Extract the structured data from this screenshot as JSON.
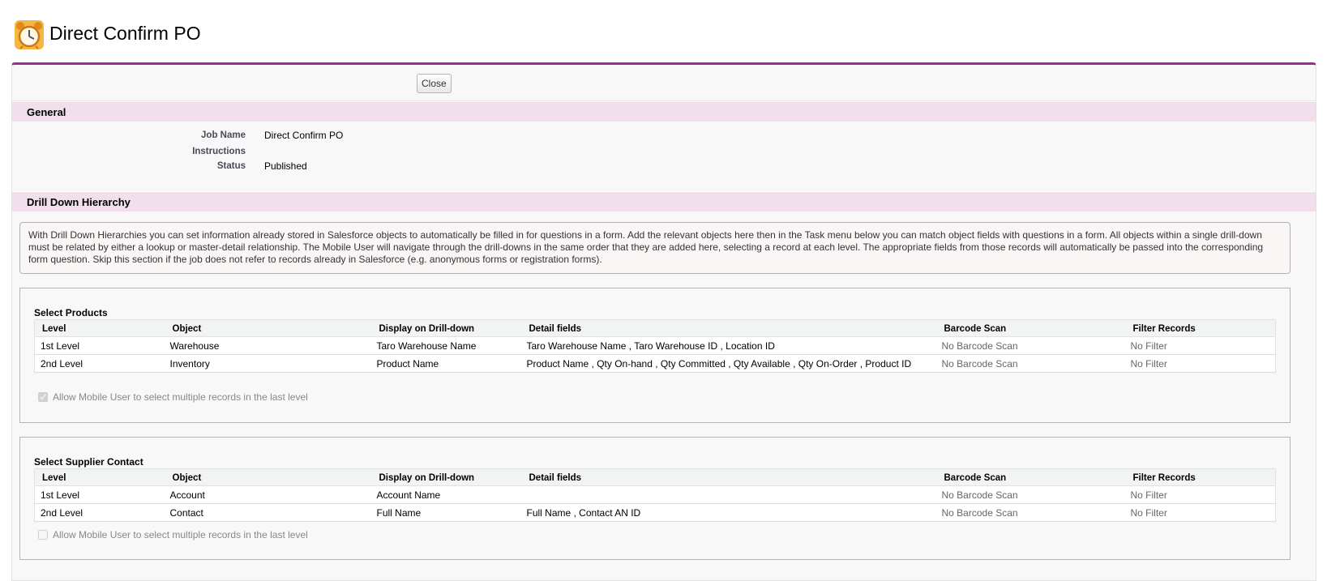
{
  "header": {
    "title": "Direct Confirm PO",
    "icon": "alarm-clock-icon"
  },
  "toolbar": {
    "close_label": "Close"
  },
  "general": {
    "heading": "General",
    "job_name_label": "Job Name",
    "job_name_value": "Direct Confirm PO",
    "instructions_label": "Instructions",
    "instructions_value": "",
    "status_label": "Status",
    "status_value": "Published"
  },
  "drilldown": {
    "heading": "Drill Down Hierarchy",
    "info": "With Drill Down Hierarchies you can set information already stored in Salesforce objects to automatically be filled in for questions in a form. Add the relevant objects here then in the Task menu below you can match object fields with questions in a form. All objects within a single drill-down must be related by either a lookup or master-detail relationship. The Mobile User will navigate through the drill-downs in the same order that they are added here, selecting a record at each level. The appropriate fields from those records will automatically be passed into the corresponding form question. Skip this section if the job does not refer to records already in Salesforce (e.g. anonymous forms or registration forms).",
    "columns": [
      "Level",
      "Object",
      "Display on Drill-down",
      "Detail fields",
      "Barcode Scan",
      "Filter Records"
    ],
    "groups": [
      {
        "title": "Select Products",
        "rows": [
          [
            "1st Level",
            "Warehouse",
            "Taro Warehouse Name",
            "Taro Warehouse Name , Taro Warehouse ID , Location ID",
            "No Barcode Scan",
            "No Filter"
          ],
          [
            "2nd Level",
            "Inventory",
            "Product Name",
            "Product Name , Qty On-hand , Qty Committed , Qty Available , Qty On-Order , Product ID",
            "No Barcode Scan",
            "No Filter"
          ]
        ],
        "multi_select_label": "Allow Mobile User to select multiple records in the last level",
        "multi_select_checked": true
      },
      {
        "title": "Select Supplier Contact",
        "rows": [
          [
            "1st Level",
            "Account",
            "Account Name",
            "",
            "No Barcode Scan",
            "No Filter"
          ],
          [
            "2nd Level",
            "Contact",
            "Full Name",
            "Full Name , Contact AN ID",
            "No Barcode Scan",
            "No Filter"
          ]
        ],
        "multi_select_label": "Allow Mobile User to select multiple records in the last level",
        "multi_select_checked": false
      }
    ]
  },
  "colors": {
    "accent": "#a02a92",
    "section_header_bg": "#f1dfeb"
  }
}
